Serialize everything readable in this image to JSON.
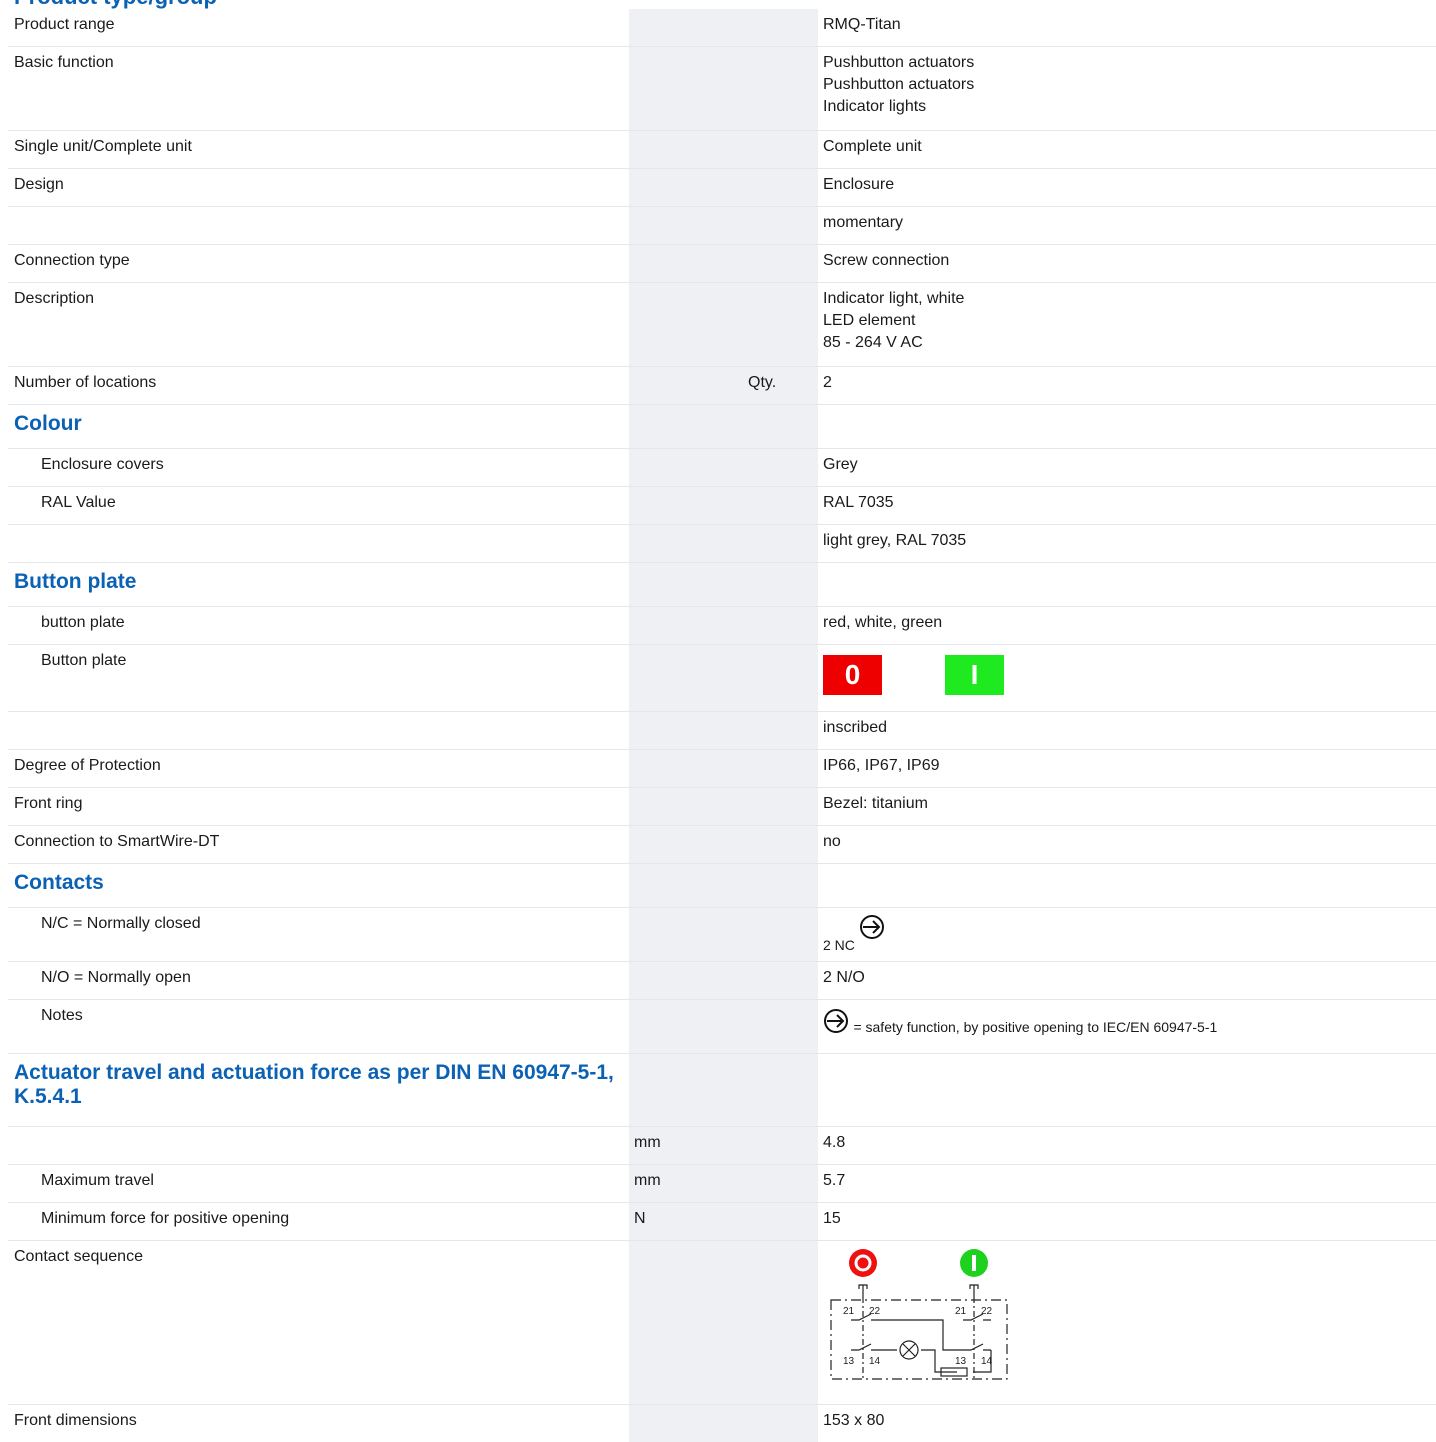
{
  "clipped_heading": "Product type/group",
  "rows": [
    {
      "label": "Product range",
      "value_lines": [
        "RMQ-Titan"
      ]
    },
    {
      "label": "Basic function",
      "value_lines": [
        "Pushbutton actuators",
        "Pushbutton actuators",
        "Indicator lights"
      ]
    },
    {
      "label": "Single unit/Complete unit",
      "value_lines": [
        "Complete unit"
      ]
    },
    {
      "label": "Design",
      "value_lines": [
        "Enclosure"
      ]
    },
    {
      "label": "",
      "value_lines": [
        "momentary"
      ]
    },
    {
      "label": "Connection type",
      "value_lines": [
        "Screw connection"
      ]
    },
    {
      "label": "Description",
      "value_lines": [
        "Indicator light, white",
        "LED element",
        "85 - 264 V AC"
      ]
    },
    {
      "label": "Number of locations",
      "unit": "Qty.",
      "value_lines": [
        "2"
      ]
    }
  ],
  "colour": {
    "heading": "Colour",
    "rows": [
      {
        "label": "Enclosure covers",
        "value": "Grey"
      },
      {
        "label": "RAL Value",
        "value": "RAL 7035"
      },
      {
        "label": "",
        "value": "light grey, RAL 7035"
      }
    ]
  },
  "button_plate": {
    "heading": "Button plate",
    "row1": {
      "label": "button plate",
      "value": "red, white, green"
    },
    "row2": {
      "label": "Button plate",
      "plate_red": "0",
      "plate_green": "I"
    },
    "row3": {
      "label": "",
      "value": "inscribed"
    },
    "red_color": "#ef0000",
    "green_color": "#1fea1f"
  },
  "more_rows": [
    {
      "label": "Degree of Protection",
      "value": "IP66, IP67, IP69"
    },
    {
      "label": "Front ring",
      "value": "Bezel: titanium"
    },
    {
      "label": "Connection to SmartWire-DT",
      "value": "no"
    }
  ],
  "contacts": {
    "heading": "Contacts",
    "nc_label": "N/C = Normally closed",
    "nc_value": "2 NC",
    "no_label": "N/O = Normally open",
    "no_value": "2 N/O",
    "notes_label": "Notes",
    "notes_value": "= safety function, by positive opening to IEC/EN 60947-5-1",
    "icon": "positive-opening-icon"
  },
  "actuator": {
    "heading_lines": [
      "Actuator travel and actuation force as per DIN EN 60947-5-1,",
      "K.5.4.1"
    ],
    "rows": [
      {
        "label": "",
        "unit": "mm",
        "value": "4.8"
      },
      {
        "label": "Maximum travel",
        "unit": "mm",
        "value": "5.7"
      },
      {
        "label": "Minimum force for positive opening",
        "unit": "N",
        "value": "15"
      }
    ]
  },
  "contact_sequence": {
    "label": "Contact sequence",
    "left_button": "O",
    "right_button": "I",
    "terminals": [
      "21",
      "22",
      "13",
      "14",
      "21",
      "22",
      "13",
      "14"
    ]
  },
  "front_dimensions": {
    "label": "Front dimensions",
    "value": "153 x 80"
  },
  "colors": {
    "heading_blue": "#0b62b5",
    "grey_column": "#eef0f3",
    "row_border": "#e3e6ea"
  }
}
